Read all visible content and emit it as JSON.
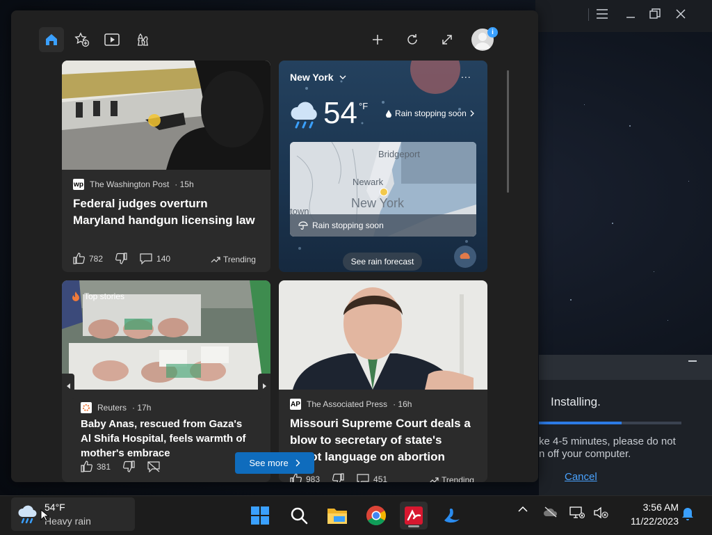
{
  "installer": {
    "title": "Installing.",
    "message_line1": "ke 4-5 minutes, please do not",
    "message_line2": "n off your computer.",
    "cancel": "Cancel",
    "progress": 0.58
  },
  "widgets": {
    "icons": {
      "home": "home-icon",
      "favorites": "star-add-icon",
      "video": "play-icon",
      "games": "chess-icon",
      "add": "plus-icon",
      "refresh": "refresh-icon",
      "expand": "expand-icon",
      "profile": "avatar-icon"
    },
    "profile_badge": "i"
  },
  "cards": {
    "wapo": {
      "source": "The Washington Post",
      "age": "15h",
      "logo": "wp",
      "headline_line1": "Federal judges overturn",
      "headline_line2": "Maryland handgun licensing law",
      "likes": "782",
      "comments": "140",
      "tag": "Trending"
    },
    "weather": {
      "location": "New York",
      "temp": "54",
      "unit": "°F",
      "condition": "Rain stopping soon",
      "map_labels": {
        "bridgeport": "Bridgeport",
        "newark": "Newark",
        "newyork": "New York",
        "town": "town"
      },
      "map_caption": "Rain stopping soon",
      "forecast_button": "See rain forecast",
      "more": "..."
    },
    "reuters": {
      "badge": "Top stories",
      "source": "Reuters",
      "age": "17h",
      "headline_line1": "Baby Anas, rescued from Gaza's",
      "headline_line2": "Al Shifa Hospital, feels warmth of",
      "headline_line3": "mother's embrace",
      "likes": "381"
    },
    "ap": {
      "source": "The Associated Press",
      "age": "16h",
      "logo": "AP",
      "headline_line1": "Missouri Supreme Court deals a",
      "headline_line2": "blow to secretary of state's",
      "headline_line3": "ballot language on abortion",
      "likes": "983",
      "comments": "451",
      "tag": "Trending"
    }
  },
  "see_more": "See more",
  "taskbar": {
    "weather": {
      "temp": "54°F",
      "condition": "Heavy rain"
    },
    "apps": [
      "start-icon",
      "search-icon",
      "file-explorer-icon",
      "chrome-icon",
      "antivirus-icon",
      "bird-app-icon"
    ],
    "time": "3:56 AM",
    "date": "11/22/2023"
  },
  "colors": {
    "accent": "#0f6cbd",
    "panel": "#202020",
    "card": "#2b2b2b",
    "taskbar": "#1c1c1c"
  }
}
